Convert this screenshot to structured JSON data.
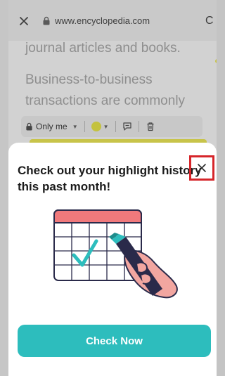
{
  "browser": {
    "url": "www.encyclopedia.com"
  },
  "article": {
    "line1": "journal articles and books.",
    "line2": "Business-to-business",
    "line3": "transactions are commonly"
  },
  "toolbar": {
    "privacy_label": "Only me",
    "highlight_color": "#c4c23e"
  },
  "sheet": {
    "title": "Check out your highlight history this past month!",
    "cta_label": "Check Now",
    "accent_color": "#2dbdbd",
    "close_highlight_color": "#d6252a"
  }
}
